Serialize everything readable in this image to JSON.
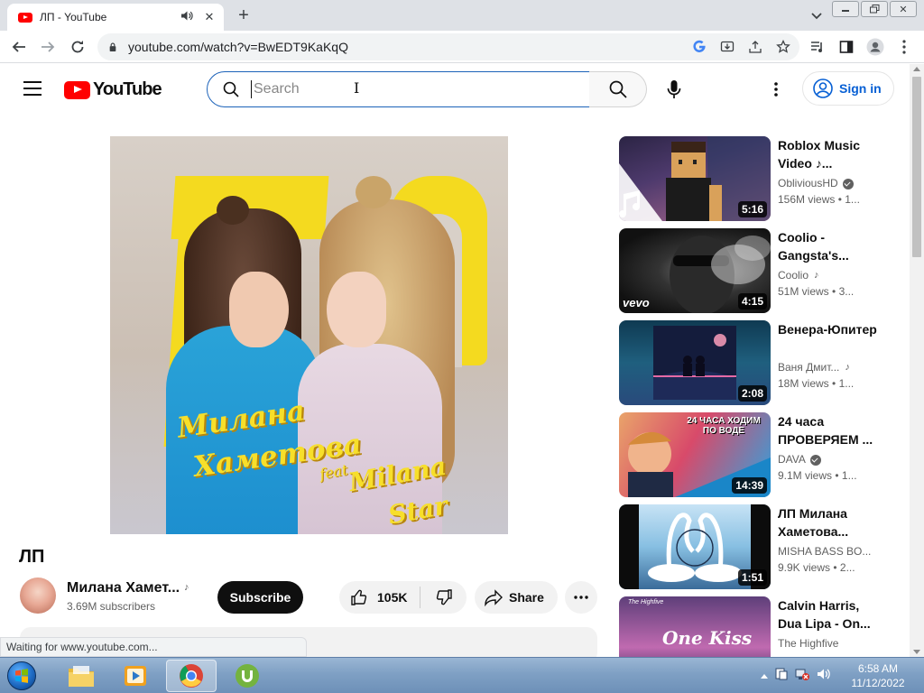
{
  "browser": {
    "tab_title": "ЛП - YouTube",
    "url": "youtube.com/watch?v=BwEDT9KaKqQ",
    "status_text": "Waiting for www.youtube.com..."
  },
  "youtube": {
    "logo_text": "YouTube",
    "search_placeholder": "Search",
    "signin_label": "Sign in"
  },
  "video": {
    "title": "ЛП",
    "thumbnail_text": {
      "line1": "Милана",
      "line2": "Хаметова",
      "feat": "feat.",
      "line3": "Milana",
      "line4": "Star"
    },
    "channel_name": "Милана Хамет...",
    "subscribers": "3.69M subscribers",
    "subscribe_label": "Subscribe",
    "likes": "105K",
    "share_label": "Share"
  },
  "recommendations": [
    {
      "title": "Roblox Music Video ♪...",
      "channel": "ObliviousHD",
      "verified": true,
      "music": false,
      "views": "156M views",
      "age": "• 1...",
      "duration": "5:16",
      "thumb_text": ""
    },
    {
      "title": "Coolio - Gangsta's...",
      "channel": "Coolio",
      "verified": false,
      "music": true,
      "views": "51M views",
      "age": "• 3...",
      "duration": "4:15",
      "thumb_text": "vevo"
    },
    {
      "title": "Венера-Юпитер",
      "channel": "Ваня Дмит...",
      "verified": false,
      "music": true,
      "views": "18M views",
      "age": "• 1...",
      "duration": "2:08",
      "thumb_text": ""
    },
    {
      "title": "24 часа ПРОВЕРЯЕМ ...",
      "channel": "DAVA",
      "verified": true,
      "music": false,
      "views": "9.1M views",
      "age": "• 1...",
      "duration": "14:39",
      "thumb_text": "24 ЧАСА ХОДИМ ПО ВОДЕ"
    },
    {
      "title": "ЛП Милана Хаметова...",
      "channel": "MISHA BASS BO...",
      "verified": false,
      "music": false,
      "views": "9.9K views",
      "age": "• 2...",
      "duration": "1:51",
      "thumb_text": ""
    },
    {
      "title": "Calvin Harris, Dua Lipa - On...",
      "channel": "The Highfive",
      "verified": false,
      "music": false,
      "views": "",
      "age": "",
      "duration": "",
      "thumb_text": "One Kiss",
      "thumb_small": "The Highfive"
    }
  ],
  "taskbar": {
    "time": "6:58 AM",
    "date": "11/12/2022"
  }
}
